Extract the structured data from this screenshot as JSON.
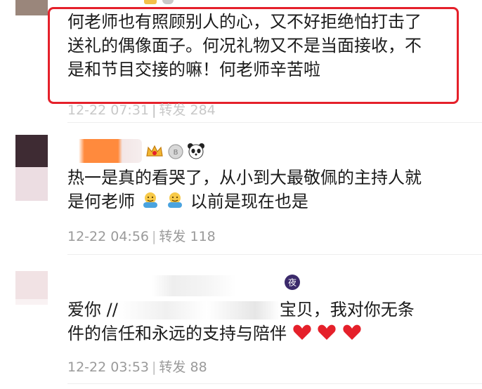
{
  "comments": [
    {
      "text_lines": [
        "何老师也有照顾别人的心，又不好拒绝怕打击了",
        "送礼的偶像面子。何况礼物又不是当面接收，不",
        "是和节目交接的嘛！何老师辛苦啦"
      ],
      "time": "12-22 07:31",
      "repost_label": "转发",
      "repost_count": "284"
    },
    {
      "text_lines": [
        "热一是真的看哭了，从小到大最敬佩的主持人就",
        "是何老师",
        "以前是现在也是"
      ],
      "time": "12-22 04:56",
      "repost_label": "转发",
      "repost_count": "118"
    },
    {
      "text_parts": {
        "line1_a": "爱你 //",
        "line1_b": "宝贝，我对你无条",
        "line2": "件的信任和永远的支持与陪伴"
      },
      "time": "12-22 03:53",
      "repost_label": "转发",
      "repost_count": "88",
      "badge_label": "夜"
    }
  ],
  "separator": "|",
  "icons": [
    "crown-badge-icon",
    "silver-medal-icon",
    "panda-icon",
    "night-badge-icon",
    "hug-emoji-icon",
    "heart-icon"
  ],
  "colors": {
    "highlight": "#e5202a",
    "meta": "#9a9a9a",
    "heart": "#e5202a",
    "redact_orange": "#ff8a3d"
  }
}
